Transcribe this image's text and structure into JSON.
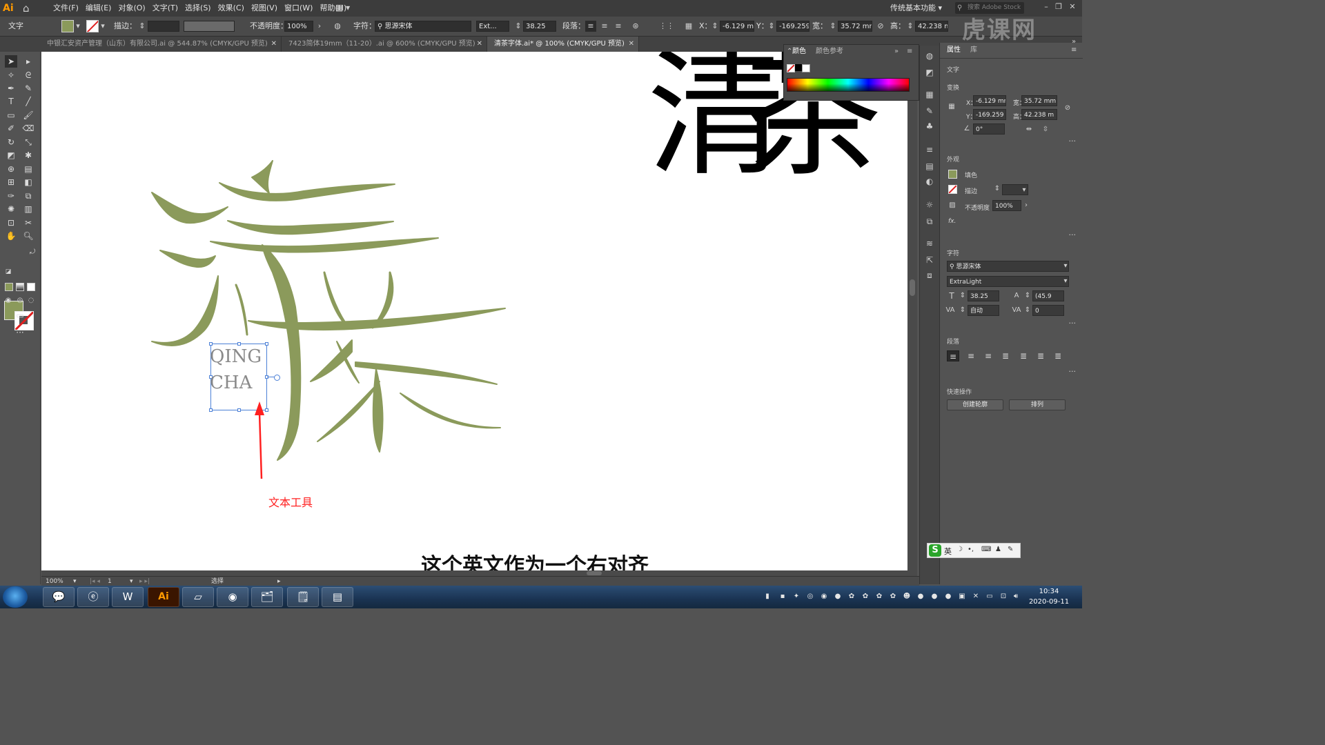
{
  "app": {
    "logo": "Ai",
    "menu": [
      "文件(F)",
      "编辑(E)",
      "对象(O)",
      "文字(T)",
      "选择(S)",
      "效果(C)",
      "视图(V)",
      "窗口(W)",
      "帮助(H)"
    ],
    "workspace": "传统基本功能",
    "stock_search_placeholder": "搜索 Adobe Stock"
  },
  "control_bar": {
    "tool_label": "文字",
    "stroke_label": "描边：",
    "opacity_label": "不透明度：",
    "opacity_value": "100%",
    "char_label": "字符：",
    "font_name": "思源宋体",
    "font_style": "Ext...",
    "font_size": "38.25",
    "para_label": "段落：",
    "x_label": "X：",
    "x_value": "-6.129 mm",
    "y_label": "Y：",
    "y_value": "-169.259",
    "w_label": "宽：",
    "w_value": "35.72 mm",
    "h_label": "高：",
    "h_value": "42.238 m"
  },
  "tabs": [
    {
      "label": "中银汇安资产管理（山东）有限公司.ai @ 544.87% (CMYK/GPU 预览)",
      "active": false
    },
    {
      "label": "7423简体19mm（11-20）.ai @ 600% (CMYK/GPU 预览)",
      "active": false
    },
    {
      "label": "清茶字体.ai* @ 100% (CMYK/GPU 预览)",
      "active": true
    }
  ],
  "canvas": {
    "art_chars": "清茶",
    "text_lines": [
      "QING",
      "CHA"
    ],
    "annotation": "文本工具",
    "subtitle": "这个英文作为一个右对齐",
    "art_color": "#8b9a5b"
  },
  "color_panel": {
    "tab_color": "颜色",
    "tab_guide": "颜色参考"
  },
  "properties": {
    "tab_props": "属性",
    "tab_lib": "库",
    "section_type": "文字",
    "section_transform": "变换",
    "x_label": "X：",
    "x_value": "-6.129 mm",
    "y_label": "Y：",
    "y_value": "-169.259",
    "w_label": "宽：",
    "w_value": "35.72 mm",
    "h_label": "高：",
    "h_value": "42.238 m",
    "angle_value": "0°",
    "section_appearance": "外观",
    "fill_label": "填色",
    "stroke_label": "描边",
    "opacity_label": "不透明度",
    "opacity_value": "100%",
    "fx_label": "fx.",
    "section_char": "字符",
    "font_name": "思源宋体",
    "font_style": "ExtraLight",
    "font_size": "38.25",
    "leading": "(45.9",
    "kerning": "自动",
    "tracking": "0",
    "section_para": "段落",
    "section_quick": "快速操作",
    "btn_outline": "创建轮廓",
    "btn_arrange": "排列"
  },
  "status": {
    "zoom": "100%",
    "artboard": "1",
    "mode": "选择"
  },
  "ime": {
    "lang": "英"
  },
  "clock": {
    "time": "10:34",
    "date": "2020-09-11"
  },
  "watermark": "虎课网"
}
